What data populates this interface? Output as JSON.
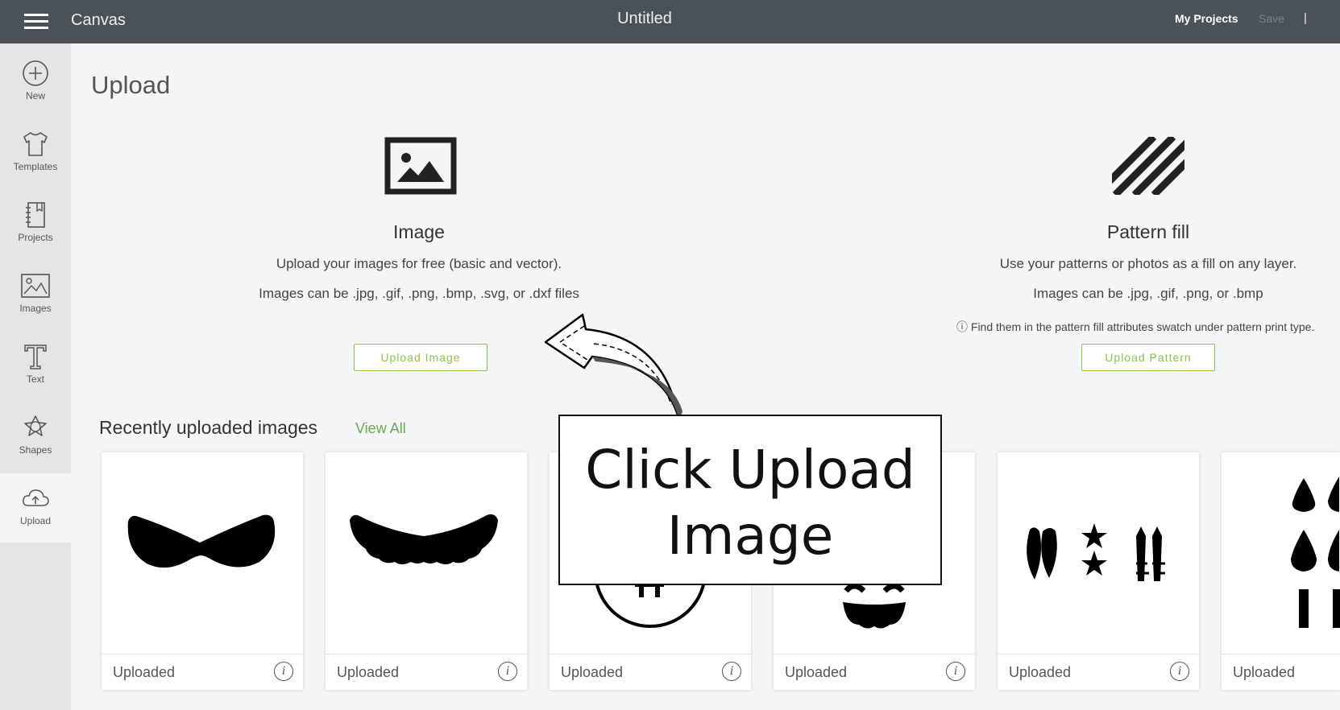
{
  "topbar": {
    "app_name": "Canvas",
    "doc_title": "Untitled",
    "my_projects": "My Projects",
    "save": "Save",
    "divider": "|",
    "bg_color": "#4b5257"
  },
  "sidebar": {
    "items": [
      {
        "label": "New",
        "icon": "plus-circle-icon"
      },
      {
        "label": "Templates",
        "icon": "shirt-icon"
      },
      {
        "label": "Projects",
        "icon": "notebook-icon"
      },
      {
        "label": "Images",
        "icon": "image-icon"
      },
      {
        "label": "Text",
        "icon": "text-t-icon"
      },
      {
        "label": "Shapes",
        "icon": "shapes-icon"
      },
      {
        "label": "Upload",
        "icon": "cloud-upload-icon"
      }
    ],
    "active": "Upload"
  },
  "main": {
    "title": "Upload",
    "image_card": {
      "title": "Image",
      "line1": "Upload your images for free (basic and vector).",
      "line2": "Images can be .jpg, .gif, .png, .bmp, .svg, or .dxf files",
      "button": "Upload Image"
    },
    "pattern_card": {
      "title": "Pattern fill",
      "line1": "Use your patterns or photos as a fill on any layer.",
      "line2": "Images can be .jpg, .gif, .png, or .bmp",
      "note": "ⓘ Find them in the pattern fill attributes swatch under pattern print type.",
      "button": "Upload Pattern"
    },
    "recent": {
      "title": "Recently uploaded images",
      "view_all": "View All",
      "items": [
        {
          "label": "Uploaded",
          "art": "mustache-1"
        },
        {
          "label": "Uploaded",
          "art": "mustache-2"
        },
        {
          "label": "Uploaded",
          "art": "coin"
        },
        {
          "label": "Uploaded",
          "art": "smiley"
        },
        {
          "label": "Uploaded",
          "art": "feathers-stars"
        },
        {
          "label": "Uploaded",
          "art": "paint-drops"
        }
      ]
    },
    "accent_color": "#8bc34a"
  },
  "callout": {
    "line1": "Click Upload",
    "line2": "Image"
  }
}
